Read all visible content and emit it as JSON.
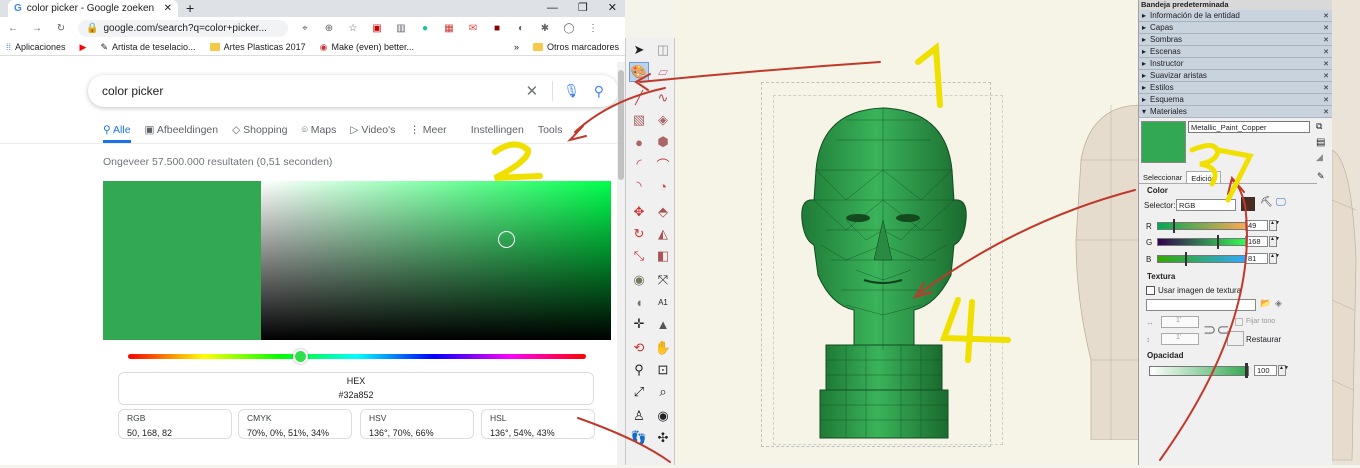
{
  "browser": {
    "tab_title": "color picker - Google zoeken",
    "window_controls": [
      "—",
      "❐",
      "✕"
    ],
    "url": "google.com/search?q=color+picker...",
    "bookmarks": [
      {
        "label": "Aplicaciones",
        "icon": "apps-grid-icon"
      },
      {
        "label": "",
        "icon": "youtube-icon"
      },
      {
        "label": "Artista de teselacio...",
        "icon": "page-icon"
      },
      {
        "label": "Artes Plasticas 2017",
        "icon": "folder-icon"
      },
      {
        "label": "Make (even) better...",
        "icon": "site-icon"
      }
    ],
    "bookmarks_more": "»",
    "other_bookmarks": "Otros marcadores"
  },
  "search": {
    "query": "color picker",
    "clear_glyph": "✕",
    "mic_glyph": "🎤",
    "lens_glyph": "🔍",
    "tabs": [
      {
        "label": "Alle",
        "icon": "🔍",
        "active": true
      },
      {
        "label": "Afbeeldingen",
        "icon": "▣"
      },
      {
        "label": "Shopping",
        "icon": "◇"
      },
      {
        "label": "Maps",
        "icon": "⌾"
      },
      {
        "label": "Video's",
        "icon": "▷"
      },
      {
        "label": "Meer",
        "icon": "⋮"
      },
      {
        "label": "Instellingen",
        "icon": ""
      },
      {
        "label": "Tools",
        "icon": ""
      }
    ],
    "result_stats": "Ongeveer 57.500.000 resultaten (0,51 seconden)"
  },
  "color_picker": {
    "selected_color": "#32a852",
    "hue_color": "#00ff4c",
    "hex_label": "HEX",
    "hex_value": "#32a852",
    "formats": [
      {
        "label": "RGB",
        "value": "50, 168, 82"
      },
      {
        "label": "CMYK",
        "value": "70%, 0%, 51%, 34%"
      },
      {
        "label": "HSV",
        "value": "136°, 70%, 66%"
      },
      {
        "label": "HSL",
        "value": "136°, 54%, 43%"
      }
    ]
  },
  "panel": {
    "title": "Bandeja predeterminada",
    "sections": [
      {
        "label": "Información de la entidad",
        "arrow": "▸"
      },
      {
        "label": "Capas",
        "arrow": "▸"
      },
      {
        "label": "Sombras",
        "arrow": "▸"
      },
      {
        "label": "Escenas",
        "arrow": "▸"
      },
      {
        "label": "Instructor",
        "arrow": "▸"
      },
      {
        "label": "Suavizar aristas",
        "arrow": "▸"
      },
      {
        "label": "Estilos",
        "arrow": "▸"
      },
      {
        "label": "Esquema",
        "arrow": "▸"
      },
      {
        "label": "Materiales",
        "arrow": "▾"
      }
    ],
    "close_glyph": "✕",
    "material_name": "Metallic_Paint_Copper",
    "material_color": "#32a852",
    "tab_select": "Seleccionar",
    "tab_edit": "Edición",
    "color_heading": "Color",
    "selector_label": "Selector:",
    "selector_value": "RGB",
    "r_label": "R",
    "r_value": "49",
    "g_label": "G",
    "g_value": "168",
    "b_label": "B",
    "b_value": "81",
    "texture_heading": "Textura",
    "use_texture_label": "Usar imagen de textura",
    "width_value": "1'",
    "height_value": "1'",
    "fix_tone_label": "Fijar tono",
    "restore_label": "Restaurar",
    "opacity_heading": "Opacidad",
    "opacity_value": "100"
  },
  "annotations": {
    "colors": {
      "handwriting": "#f0e000",
      "arrows": "#c0392b"
    },
    "numbers": [
      "1",
      "2",
      "3",
      "4"
    ]
  }
}
